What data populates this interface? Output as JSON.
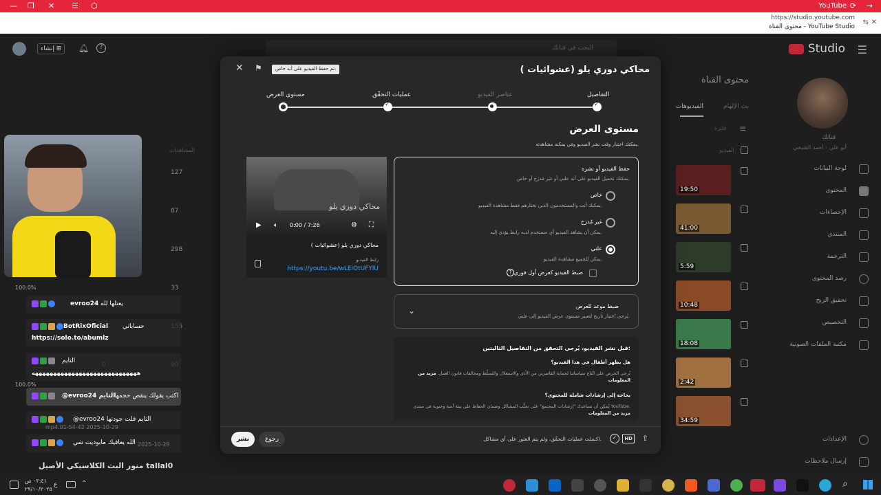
{
  "browser": {
    "tab_title": "YouTube",
    "url": "https://studio.youtube.com",
    "page_title": "محتوى القناة - YouTube Studio"
  },
  "studio": {
    "logo": "Studio",
    "search_placeholder": "البحث في قناتك",
    "create_label": "إنشاء",
    "page_heading": "محتوى القناة",
    "tabs": [
      "الفيديوهات",
      "بث الإلهام"
    ],
    "filter_label": "فلترة",
    "column_video": "الفيديو",
    "column_views": "المشاهدات",
    "channel_name": "قناتك",
    "channel_sub": "أبو علي - أحمد الشيخي",
    "sidebar": [
      "لوحة البيانات",
      "المحتوى",
      "الإحصاءات",
      "المنتدى",
      "الترجمة",
      "رصد المحتوى",
      "تحقيق الربح",
      "التخصيص",
      "مكتبة الملفات الصوتية"
    ],
    "sidebar_bottom": [
      "الإعدادات",
      "إرسال ملاحظات"
    ],
    "rows": [
      {
        "duration": "19:50",
        "views": "127",
        "color": "#5a2020"
      },
      {
        "duration": "41:00",
        "views": "87",
        "color": "#7a5a30"
      },
      {
        "duration": "5:59",
        "views": "298",
        "color": "#2e3a2a"
      },
      {
        "duration": "10:48",
        "views": "33",
        "color": "#8a4a28"
      },
      {
        "duration": "18:08",
        "views": "155",
        "color": "#3a7a4a"
      },
      {
        "duration": "2:42",
        "views": "0",
        "color": "#a07040"
      },
      {
        "duration": "34:59",
        "views": "90",
        "color": "#8a5030"
      }
    ]
  },
  "modal": {
    "title": "محاكي دوري يلو (عشوائيات )",
    "saved_badge": "تم حفظ الفيديو على أنه خاص.",
    "steps": [
      "التفاصيل",
      "عناصر الفيديو",
      "عمليات التحقّق",
      "مستوى العرض"
    ],
    "section_title": "مستوى العرض",
    "section_sub": "يمكنك اختيار وقت نشر الفيديو ومَن يمكنه مشاهدته.",
    "save_publish": {
      "title": "حفظ الفيديو أو نشره",
      "sub": "يمكنك تحميل الفيديو على أنه علني أو غير مُدرَج أو خاص.",
      "options": [
        {
          "label": "خاص",
          "desc": "يمكنك أنت والمستخدمون الذين تختارهم فقط مشاهدة الفيديو.",
          "selected": false
        },
        {
          "label": "غير مُدرَج",
          "desc": "يمكن أن يشاهد الفيديو أي مستخدم لديه رابط يؤدي إليه.",
          "selected": false
        },
        {
          "label": "علني",
          "desc": "يمكن للجميع مشاهدة الفيديو.",
          "selected": true
        }
      ],
      "premiere": "ضبط الفيديو كعرض أول فوري"
    },
    "schedule": {
      "title": "ضبط موعد للعرض",
      "sub": "يُرجى اختيار تاريخ لتغيير مستوى عرض الفيديو إلى علني."
    },
    "checklist": {
      "title": "قبل نشر الفيديو، يُرجى التحقق من التفاصيل التاليتين:",
      "q1": "هل يظهر أطفال في هذا الفيديو؟",
      "a1": "يُرجى الحرص على اتّباع سياساتنا لحماية القاصرين من الأذى والاستغلال والتسلّط ومخالفات قانون العمل.",
      "a1_link": "مزيد من المعلومات",
      "q2": "بحاجة إلى إرشادات شاملة للمحتوى؟",
      "a2": "يُمكِن أن تساعدك \"إرشادات المجتمع\" على تجنُّب المشاكل وضمان الحفاظ على بيئة آمنة وحيوية في منتدى YouTube.",
      "a2_link": "مزيد من المعلومات"
    },
    "preview": {
      "video_title": "محاكي دوري يلو (عشوائيات )",
      "time": "0:00 / 7:26",
      "link_label": "رابط الفيديو",
      "link": "https://youtu.be/wLEiOtUFYlU",
      "overlay_text": "محاكي دوري يلو"
    },
    "footer": {
      "status": "اكتملت عمليات التحقّق، ولم يتم العثور على أي مشاكل.",
      "hd": "HD",
      "back": "رجوع",
      "publish": "نشر"
    }
  },
  "stream": {
    "chat": [
      {
        "user": "evroo24",
        "text": "يعتلها لله"
      },
      {
        "user": "BotRixOficial",
        "text": "حساباتي",
        "extra": "https://solo.to/abumlz"
      },
      {
        "user": "",
        "text": "التايم",
        "extra": "هههههههههههههههههههههههههههههه"
      },
      {
        "user": "evroo24",
        "text": "اكتب يقولك ينقص حجمها",
        "reply": "@evroo24 التايم"
      },
      {
        "user": "evroo24",
        "text": "@evroo24 التايم قلت جودتها"
      },
      {
        "user": "evroo24",
        "text": "الله يعافيك مابوديت شي"
      }
    ],
    "percents": [
      "100.0%",
      "100.0%"
    ],
    "file_label": "mp4.01-54-42 2025-10-29",
    "file_label2": "2025-10-29",
    "banner": "منور البث الكلاسيكي الأصيل tallal0"
  },
  "taskbar": {
    "time": "٠٢:٤١ ص",
    "date": "٢٩/١٠/٢٠٢٥",
    "lang": "ع"
  }
}
